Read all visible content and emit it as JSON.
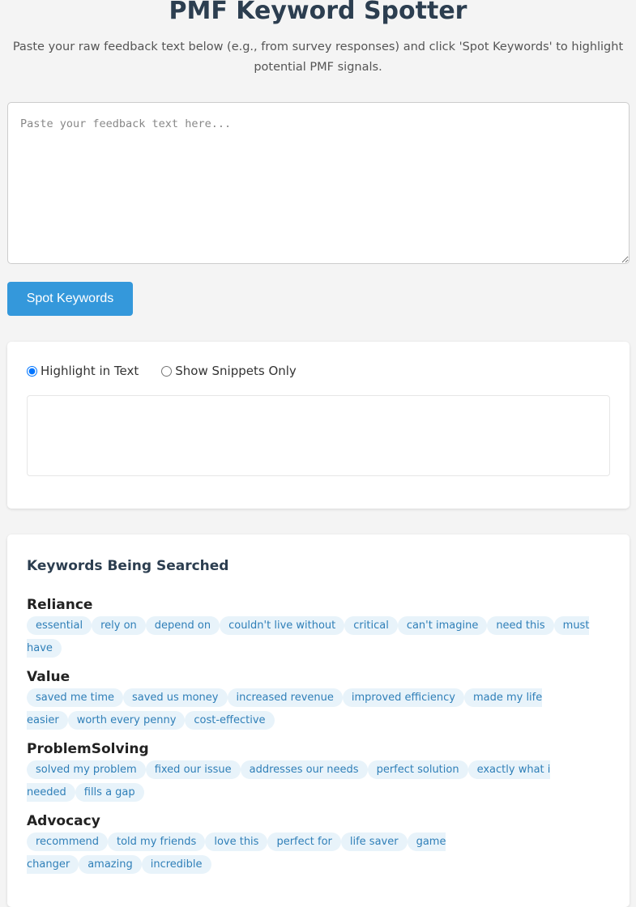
{
  "header": {
    "title": "PMF Keyword Spotter",
    "subtitle": "Paste your raw feedback text below (e.g., from survey responses) and click 'Spot Keywords' to highlight potential PMF signals."
  },
  "input": {
    "placeholder": "Paste your feedback text here...",
    "value": ""
  },
  "spot_button": {
    "label": "Spot Keywords"
  },
  "results": {
    "modes": [
      {
        "label": "Highlight in Text",
        "selected": true
      },
      {
        "label": "Show Snippets Only",
        "selected": false
      }
    ],
    "output": ""
  },
  "keywords": {
    "heading": "Keywords Being Searched",
    "categories": [
      {
        "name": "Reliance",
        "terms": [
          "essential",
          "rely on",
          "depend on",
          "couldn't live without",
          "critical",
          "can't imagine",
          "need this",
          "must have"
        ]
      },
      {
        "name": "Value",
        "terms": [
          "saved me time",
          "saved us money",
          "increased revenue",
          "improved efficiency",
          "made my life easier",
          "worth every penny",
          "cost-effective"
        ]
      },
      {
        "name": "ProblemSolving",
        "terms": [
          "solved my problem",
          "fixed our issue",
          "addresses our needs",
          "perfect solution",
          "exactly what i needed",
          "fills a gap"
        ]
      },
      {
        "name": "Advocacy",
        "terms": [
          "recommend",
          "told my friends",
          "love this",
          "perfect for",
          "life saver",
          "game changer",
          "amazing",
          "incredible"
        ]
      }
    ]
  }
}
